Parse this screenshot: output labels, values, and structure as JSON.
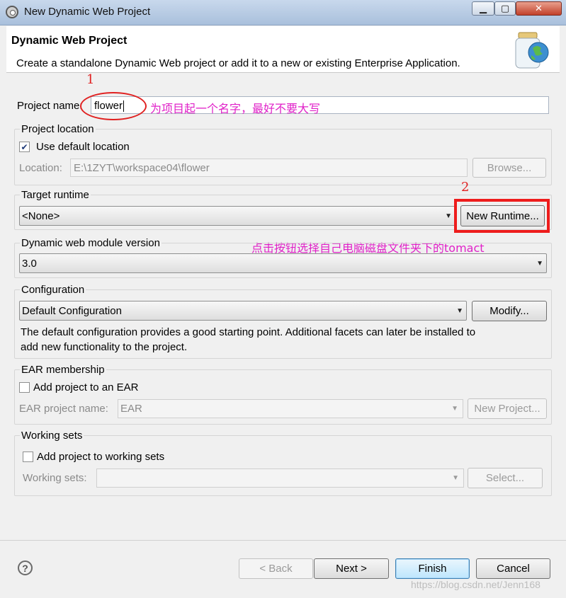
{
  "window": {
    "title": "New Dynamic Web Project",
    "min_glyph": "▁",
    "max_glyph": "▢",
    "close_glyph": "✕"
  },
  "header": {
    "title": "Dynamic Web Project",
    "description": "Create a standalone Dynamic Web project or add it to a new or existing Enterprise Application."
  },
  "project_name": {
    "label": "Project name:",
    "value": "flower"
  },
  "project_location": {
    "group_label": "Project location",
    "use_default_label": "Use default location",
    "use_default_checked": true,
    "location_label": "Location:",
    "location_value": "E:\\1ZYT\\workspace04\\flower",
    "browse_label": "Browse..."
  },
  "target_runtime": {
    "group_label": "Target runtime",
    "selected": "<None>",
    "new_runtime_label": "New Runtime..."
  },
  "module_version": {
    "group_label": "Dynamic web module version",
    "selected": "3.0"
  },
  "configuration": {
    "group_label": "Configuration",
    "selected": "Default Configuration",
    "modify_label": "Modify...",
    "description_line1": "The default configuration provides a good starting point. Additional facets can later be installed to",
    "description_line2": "add new functionality to the project."
  },
  "ear": {
    "group_label": "EAR membership",
    "add_label": "Add project to an EAR",
    "add_checked": false,
    "name_label": "EAR project name:",
    "name_value": "EAR",
    "new_project_label": "New Project..."
  },
  "working_sets": {
    "group_label": "Working sets",
    "add_label": "Add project to working sets",
    "add_checked": false,
    "sets_label": "Working sets:",
    "sets_value": "",
    "select_label": "Select..."
  },
  "footer": {
    "help_glyph": "?",
    "back_label": "< Back",
    "next_label": "Next >",
    "finish_label": "Finish",
    "cancel_label": "Cancel"
  },
  "annotations": {
    "num1": "1",
    "num2": "2",
    "note1": "为项目起一个名字，最好不要大写",
    "note2": "点击按钮选择自己电脑磁盘文件夹下的tomact"
  },
  "watermark": "https://blog.csdn.net/Jenn168",
  "colors": {
    "annotation_pink": "#e020c8",
    "annotation_red": "#e02020"
  }
}
